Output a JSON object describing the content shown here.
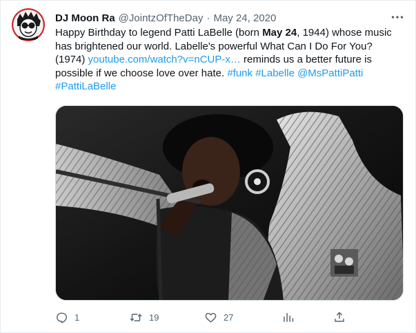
{
  "tweet": {
    "author_name": "DJ Moon Ra",
    "handle": "@JointzOfTheDay",
    "separator": "·",
    "date": "May 24, 2020",
    "body": {
      "l1_a": "Happy Birthday to legend Patti LaBelle (born ",
      "l1_bold": "May 24",
      "l1_b": ", 1944) whose music",
      "l2": "has brightened our world. Labelle's powerful What Can I Do For You?",
      "l3_a": "(1974) ",
      "l3_link": "youtube.com/watch?v=nCUP-x…",
      "l3_b": " reminds us a better future is",
      "l4_a": "possible if we choose love over hate. ",
      "l4_h1": "#funk",
      "l4_h2": "#Labelle",
      "l4_m1": "@MsPattiPatti",
      "l5_h3": "#PattiLaBelle"
    }
  },
  "actions": {
    "reply_count": "1",
    "retweet_count": "19",
    "like_count": "27"
  },
  "icons": {
    "more": "more-horizontal-icon",
    "reply": "reply-icon",
    "retweet": "retweet-icon",
    "like": "heart-icon",
    "analytics": "analytics-icon",
    "share": "share-icon"
  },
  "colors": {
    "link": "#1d9bf0",
    "secondary_text": "#536471",
    "primary_text": "#0f1419"
  }
}
